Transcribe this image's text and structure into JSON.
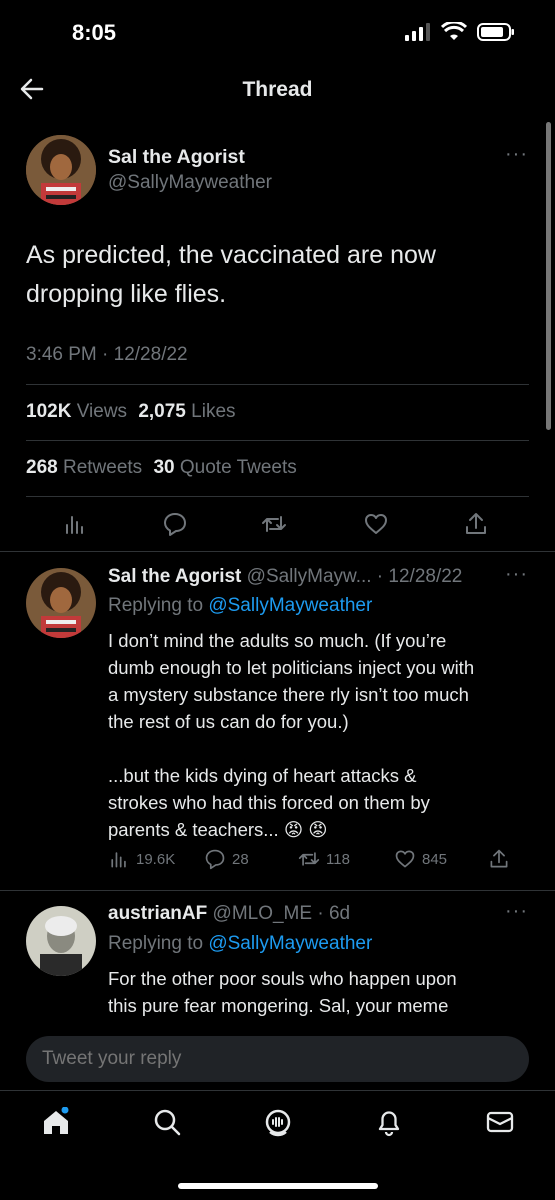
{
  "status": {
    "time": "8:05"
  },
  "header": {
    "title": "Thread"
  },
  "main_tweet": {
    "author_name": "Sal the Agorist",
    "handle": "@SallyMayweather",
    "text_line1": "As predicted, the vaccinated are now",
    "text_line2": "dropping like flies.",
    "timestamp": "3:46 PM · 12/28/22",
    "views_count": "102K",
    "views_label": "Views",
    "likes_count": "2,075",
    "likes_label": "Likes",
    "retweets_count": "268",
    "retweets_label": "Retweets",
    "quotes_count": "30",
    "quotes_label": "Quote Tweets"
  },
  "reply1": {
    "author_name": "Sal the Agorist",
    "handle_date": "@SallyMayw... · 12/28/22",
    "replying_prefix": "Replying to",
    "replying_handle": "@SallyMayweather",
    "lines": [
      "I don’t mind the adults so much. (If you’re",
      "dumb enough to let politicians inject you with",
      "a mystery substance there rly isn’t too much",
      "the rest of us can do for you.)",
      "...but the kids dying of heart attacks &",
      "strokes who had this forced on them by",
      "parents & teachers... 😡 😡"
    ],
    "views": "19.6K",
    "replies": "28",
    "retweets": "118",
    "likes": "845"
  },
  "reply2": {
    "author_name": "austrianAF",
    "handle_date": "@MLO_ME · 6d",
    "replying_prefix": "Replying to",
    "replying_handle": "@SallyMayweather",
    "lines": [
      "For the other poor souls who happen upon",
      "this pure fear mongering. Sal, your meme"
    ]
  },
  "compose": {
    "placeholder": "Tweet your reply"
  },
  "icons": {
    "back": "arrow-left-icon",
    "more": "more-dots-icon",
    "views": "bar-chart-icon",
    "reply": "speech-bubble-icon",
    "retweet": "retweet-icon",
    "like": "heart-icon",
    "share": "share-icon",
    "home": "home-icon",
    "search": "search-icon",
    "spaces": "spaces-icon",
    "notifications": "bell-icon",
    "messages": "mail-icon"
  },
  "colors": {
    "background": "#000000",
    "text": "#e7e9ea",
    "muted": "#71767b",
    "link": "#1d9bf0",
    "divider": "#2f3336"
  }
}
